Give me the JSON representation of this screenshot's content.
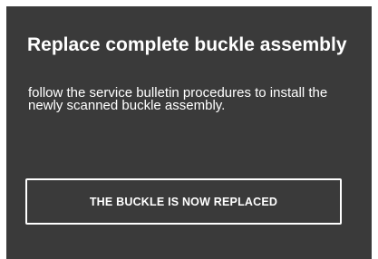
{
  "dialog": {
    "title": "Replace complete buckle assembly",
    "message": "follow the service bulletin procedures to install the newly scanned buckle assembly.",
    "confirm_button_label": "THE BUCKLE IS NOW REPLACED"
  },
  "colors": {
    "panel_background": "#3a3a3a",
    "text": "#ffffff",
    "button_border": "#ffffff"
  }
}
